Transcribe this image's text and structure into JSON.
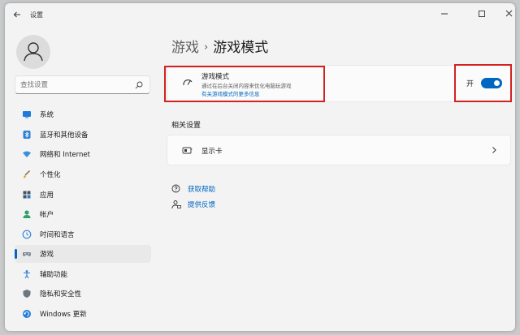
{
  "window": {
    "title": "设置"
  },
  "search": {
    "placeholder": "查找设置"
  },
  "sidebar": {
    "items": [
      {
        "label": "系统",
        "icon": "monitor-icon",
        "active": false
      },
      {
        "label": "蓝牙和其他设备",
        "icon": "bluetooth-icon",
        "active": false
      },
      {
        "label": "网络和 Internet",
        "icon": "wifi-icon",
        "active": false
      },
      {
        "label": "个性化",
        "icon": "brush-icon",
        "active": false
      },
      {
        "label": "应用",
        "icon": "apps-icon",
        "active": false
      },
      {
        "label": "帐户",
        "icon": "person-icon",
        "active": false
      },
      {
        "label": "时间和语言",
        "icon": "globe-clock-icon",
        "active": false
      },
      {
        "label": "游戏",
        "icon": "gamepad-icon",
        "active": true
      },
      {
        "label": "辅助功能",
        "icon": "accessibility-icon",
        "active": false
      },
      {
        "label": "隐私和安全性",
        "icon": "shield-icon",
        "active": false
      },
      {
        "label": "Windows 更新",
        "icon": "update-icon",
        "active": false
      }
    ]
  },
  "breadcrumb": {
    "parent": "游戏",
    "separator": "›",
    "current": "游戏模式"
  },
  "game_mode": {
    "title": "游戏模式",
    "description": "通过在后台关闭内容来优化电脑玩游戏",
    "link": "有关游戏模式的更多信息",
    "toggle_label": "开",
    "enabled": true
  },
  "related": {
    "title": "相关设置",
    "display_label": "显示卡"
  },
  "help": {
    "get_help": "获取帮助",
    "feedback": "提供反馈"
  },
  "colors": {
    "accent": "#0067c0",
    "highlight": "#d42222"
  }
}
